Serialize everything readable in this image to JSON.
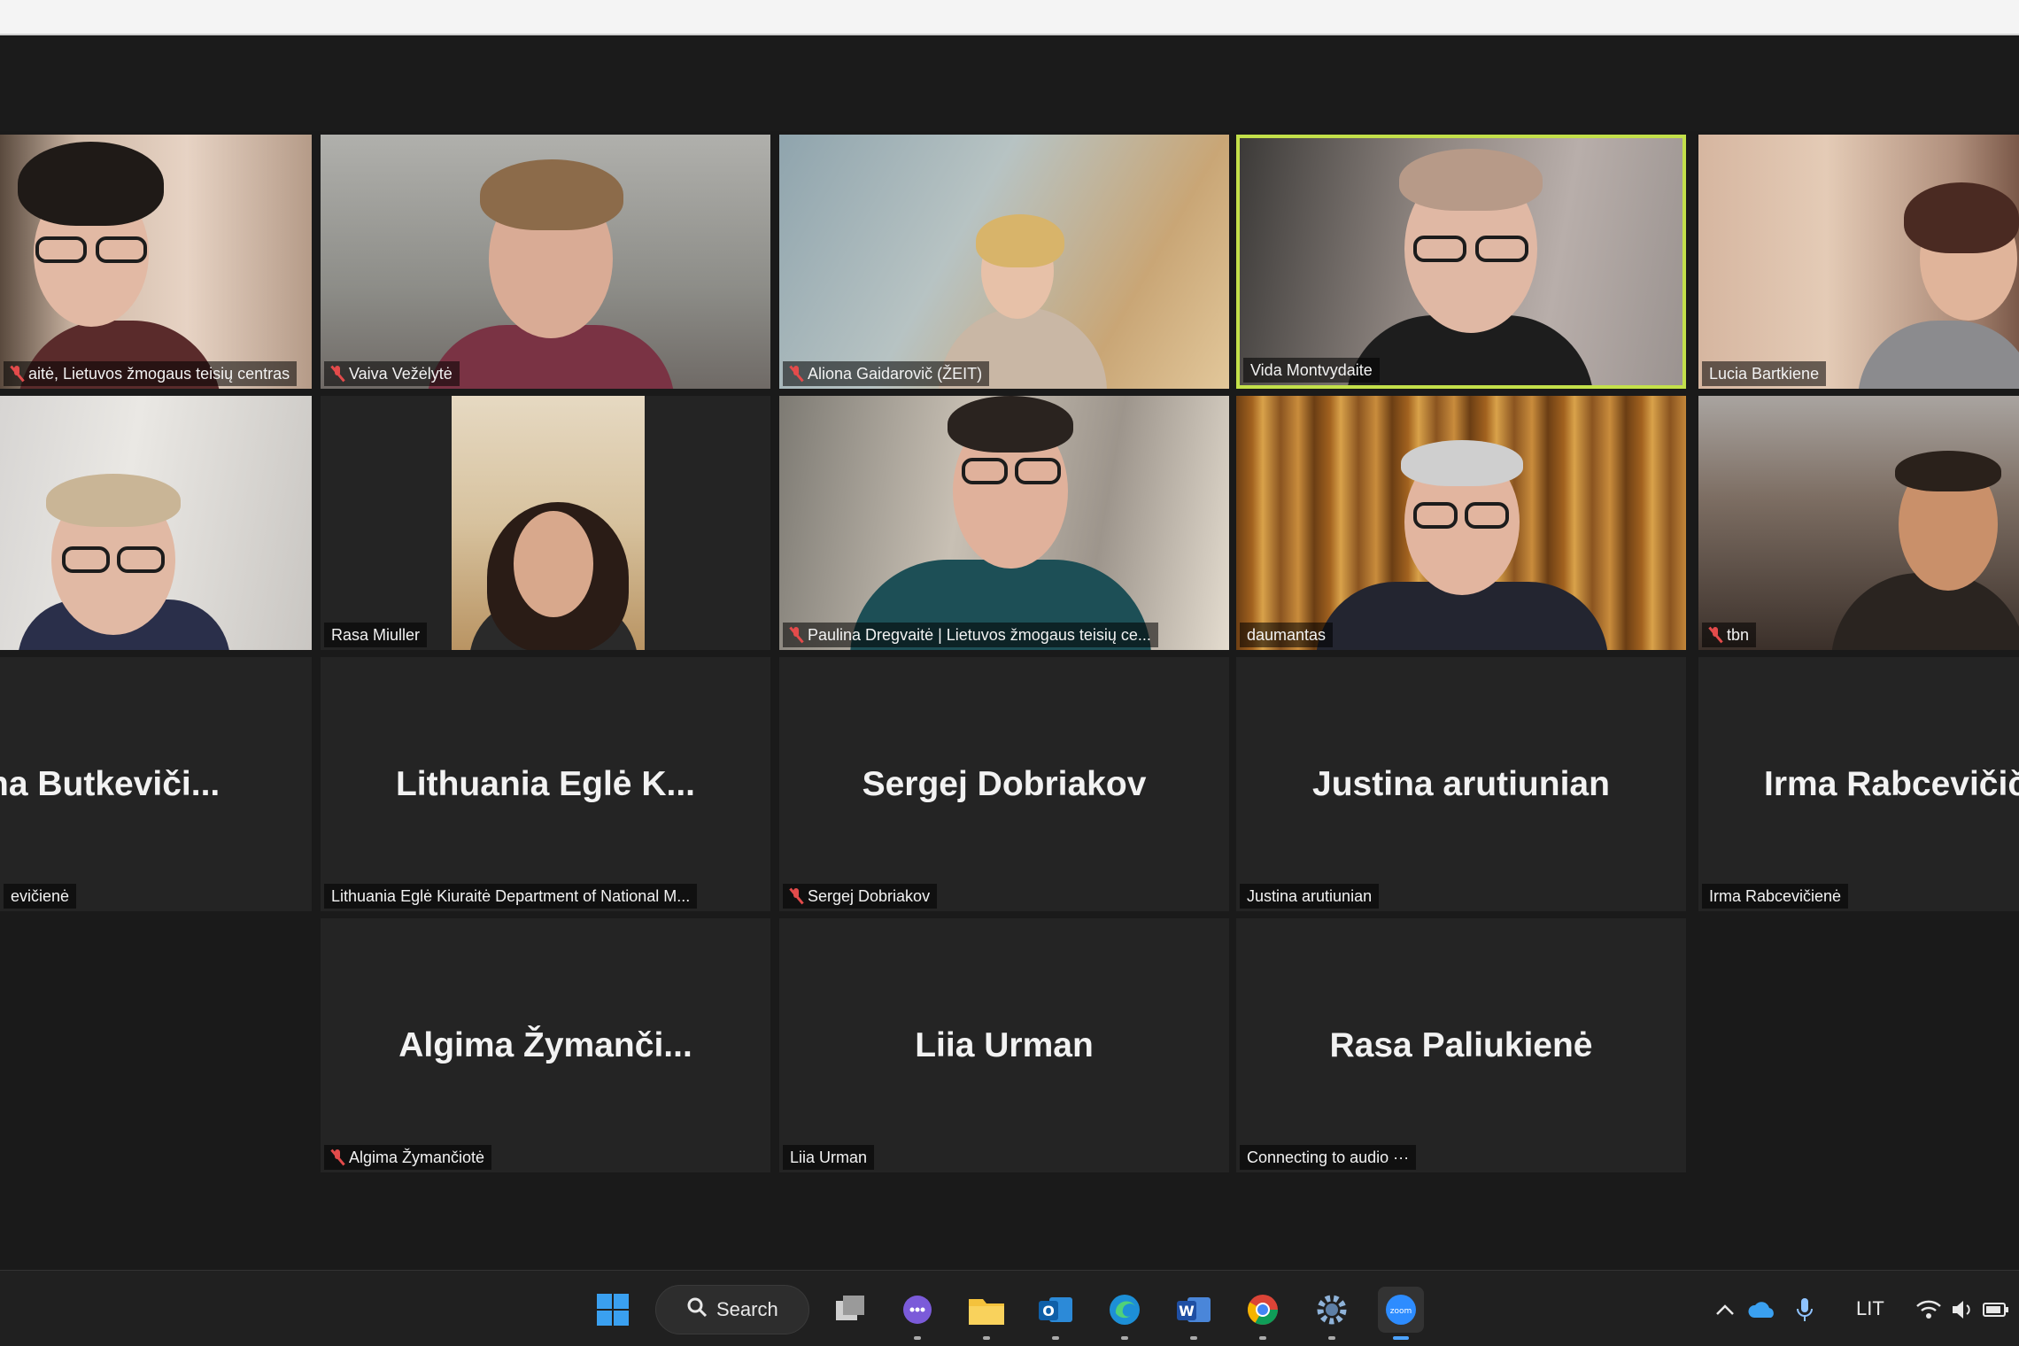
{
  "colors": {
    "speaking_border": "#c3e04a",
    "muted_icon": "#e34b4b",
    "tile_bg": "#242424",
    "page_bg": "#1a1a1a"
  },
  "tiles": [
    {
      "name_tag": "aitė, Lietuvos žmogaus teisių centras",
      "muted": true
    },
    {
      "name_tag": "Vaiva Vežėlytė",
      "muted": true
    },
    {
      "name_tag": "Aliona Gaidarovič (ŽEIT)",
      "muted": true
    },
    {
      "name_tag": "Vida Montvydaite",
      "muted": false,
      "speaking": true
    },
    {
      "name_tag": "Lucia Bartkiene",
      "muted": false
    },
    {
      "name_tag": "",
      "muted": false
    },
    {
      "name_tag": "Rasa Miuller",
      "muted": false
    },
    {
      "name_tag": "Paulina Dregvaitė | Lietuvos žmogaus teisių ce...",
      "muted": true
    },
    {
      "name_tag": "daumantas",
      "muted": false
    },
    {
      "name_tag": "tbn",
      "muted": true
    },
    {
      "big_name": "na  Butkeviči...",
      "name_tag": "evičienė",
      "muted": false
    },
    {
      "big_name": "Lithuania  Eglė  K...",
      "name_tag": "Lithuania Eglė Kiuraitė Department of National M...",
      "muted": false
    },
    {
      "big_name": "Sergej  Dobriakov",
      "name_tag": "Sergej Dobriakov",
      "muted": true
    },
    {
      "big_name": "Justina  arutiunian",
      "name_tag": "Justina arutiunian",
      "muted": false
    },
    {
      "big_name": "Irma  Rabcevičič",
      "name_tag": "Irma Rabcevičienė",
      "muted": false
    },
    {
      "big_name": "Algima  Žymanči...",
      "name_tag": "Algima Žymančiotė",
      "muted": true
    },
    {
      "big_name": "Liia  Urman",
      "name_tag": "Liia Urman",
      "muted": false
    },
    {
      "big_name": "Rasa  Paliukienė",
      "name_tag": "Connecting to audio ···",
      "muted": false
    }
  ],
  "taskbar": {
    "search_label": "Search",
    "apps": [
      "windows-start-icon",
      "task-view-icon",
      "teams-chat-icon",
      "file-explorer-icon",
      "outlook-icon",
      "edge-icon",
      "word-icon",
      "chrome-icon",
      "settings-icon",
      "zoom-icon"
    ],
    "language": "LIT"
  }
}
